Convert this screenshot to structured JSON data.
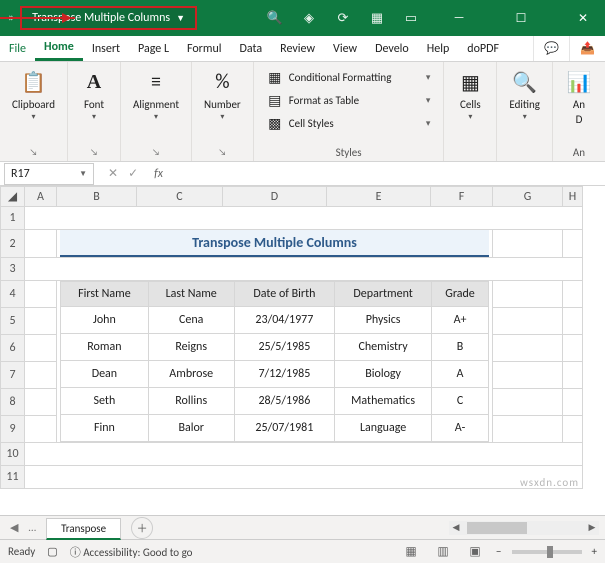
{
  "title_dropdown": "Transpose Multiple Columns",
  "menu": {
    "file": "File",
    "home": "Home",
    "insert": "Insert",
    "pagelayout": "Page L",
    "formulas": "Formul",
    "data": "Data",
    "review": "Review",
    "view": "View",
    "developer": "Develo",
    "help": "Help",
    "dopdf": "doPDF"
  },
  "ribbon": {
    "clipboard_label": "Clipboard",
    "font_label": "Font",
    "alignment_label": "Alignment",
    "number_label": "Number",
    "styles_label": "Styles",
    "cells_label": "Cells",
    "editing_label": "Editing",
    "addins_label": "An",
    "addins_sub": "D",
    "cond_fmt": "Conditional Formatting",
    "fmt_table": "Format as Table",
    "cell_styles": "Cell Styles",
    "addins_group": "An"
  },
  "namebox": "R17",
  "fx_label": "fx",
  "formula_value": "",
  "columns": [
    "A",
    "B",
    "C",
    "D",
    "E",
    "F",
    "G",
    "H"
  ],
  "rows": [
    "1",
    "2",
    "3",
    "4",
    "5",
    "6",
    "7",
    "8",
    "9",
    "10",
    "11"
  ],
  "sheet_title": "Transpose Multiple Columns",
  "headers": [
    "First Name",
    "Last Name",
    "Date of Birth",
    "Department",
    "Grade"
  ],
  "data": [
    [
      "John",
      "Cena",
      "23/04/1977",
      "Physics",
      "A+"
    ],
    [
      "Roman",
      "Reigns",
      "25/5/1985",
      "Chemistry",
      "B"
    ],
    [
      "Dean",
      "Ambrose",
      "7/12/1985",
      "Biology",
      "A"
    ],
    [
      "Seth",
      "Rollins",
      "28/5/1986",
      "Mathematics",
      "C"
    ],
    [
      "Finn",
      "Balor",
      "25/07/1981",
      "Language",
      "A-"
    ]
  ],
  "sheet_tab": "Transpose",
  "status_ready": "Ready",
  "status_access": "Accessibility: Good to go",
  "watermark": "wsxdn.com"
}
